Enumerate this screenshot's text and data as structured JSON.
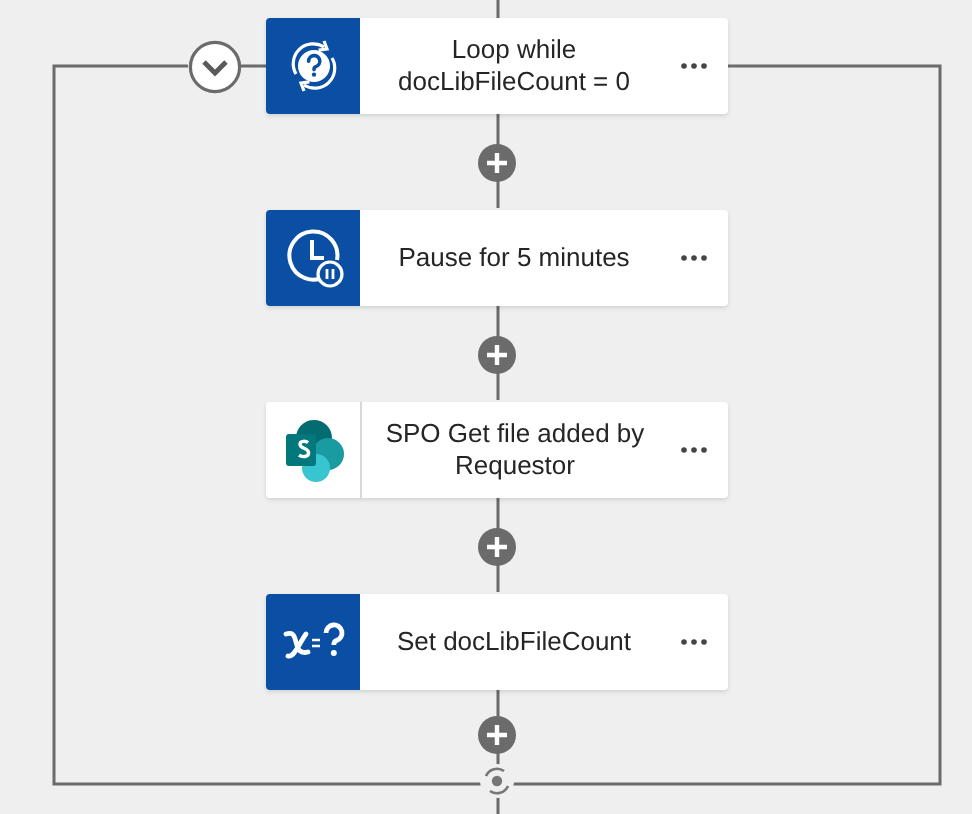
{
  "loop": {
    "expanded": true
  },
  "steps": [
    {
      "kind": "loop",
      "title": "Loop while docLibFileCount = 0"
    },
    {
      "kind": "delay",
      "title": "Pause for 5 minutes"
    },
    {
      "kind": "sharepoint",
      "title": "SPO Get file added by Requestor"
    },
    {
      "kind": "variable",
      "title": "Set docLibFileCount"
    }
  ]
}
